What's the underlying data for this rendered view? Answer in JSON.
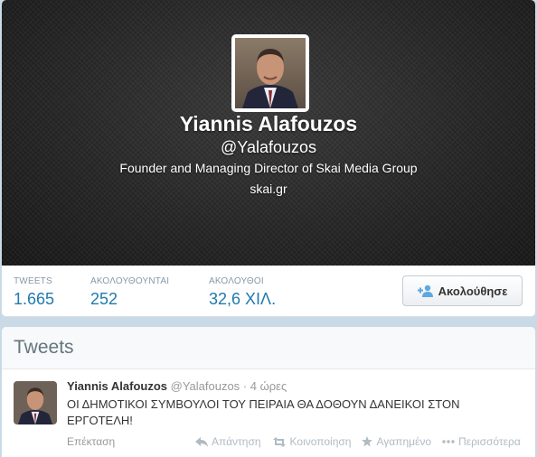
{
  "profile": {
    "name": "Yiannis Alafouzos",
    "handle": "@Yalafouzos",
    "bio": "Founder and Managing Director of Skai Media Group",
    "url": "skai.gr"
  },
  "stats": [
    {
      "label": "TWEETS",
      "value": "1.665"
    },
    {
      "label": "ΑΚΟΛΟΥΘΟΥΝΤΑΙ",
      "value": "252"
    },
    {
      "label": "ΑΚΟΛΟΥΘΟΙ",
      "value": "32,6 ΧΙΛ."
    }
  ],
  "follow_button": {
    "label": "Ακολούθησε"
  },
  "tweets_section": {
    "title": "Tweets"
  },
  "tweet": {
    "author": "Yiannis Alafouzos",
    "handle": "@Yalafouzos",
    "separator": "·",
    "time": "4 ώρες",
    "text": "ΟΙ ΔΗΜΟΤΙΚΟΙ ΣΥΜΒΟΥΛΟΙ ΤΟΥ ΠΕΙΡΑΙΑ ΘΑ ΔΟΘΟΥΝ ΔΑΝΕΙΚΟΙ ΣΤΟΝ ΕΡΓΟΤΕΛΗ!",
    "expand": "Επέκταση",
    "actions": {
      "reply": "Απάντηση",
      "retweet": "Κοινοποίηση",
      "favorite": "Αγαπημένο",
      "more": "Περισσότερα"
    }
  },
  "colors": {
    "link": "#1f7aad",
    "muted": "#8899a6",
    "header": "#262626"
  },
  "icons": [
    "follow-user-icon",
    "reply-icon",
    "retweet-icon",
    "favorite-star-icon",
    "more-icon"
  ]
}
